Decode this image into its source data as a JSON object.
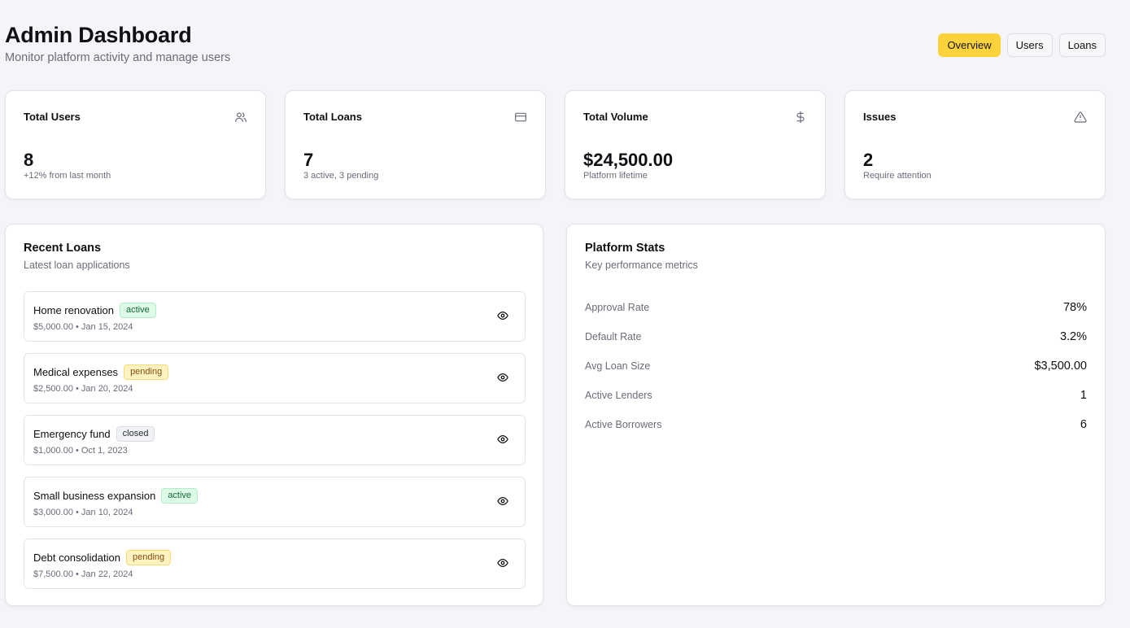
{
  "header": {
    "title": "Admin Dashboard",
    "subtitle": "Monitor platform activity and manage users"
  },
  "tabs": [
    {
      "label": "Overview",
      "active": true
    },
    {
      "label": "Users",
      "active": false
    },
    {
      "label": "Loans",
      "active": false
    }
  ],
  "stats": [
    {
      "title": "Total Users",
      "value": "8",
      "sub": "+12% from last month",
      "icon": "users-icon"
    },
    {
      "title": "Total Loans",
      "value": "7",
      "sub": "3 active, 3 pending",
      "icon": "credit-card-icon"
    },
    {
      "title": "Total Volume",
      "value": "$24,500.00",
      "sub": "Platform lifetime",
      "icon": "dollar-icon"
    },
    {
      "title": "Issues",
      "value": "2",
      "sub": "Require attention",
      "icon": "alert-triangle-icon"
    }
  ],
  "recent_loans": {
    "title": "Recent Loans",
    "subtitle": "Latest loan applications",
    "items": [
      {
        "name": "Home renovation",
        "status": "active",
        "meta": "$5,000.00 • Jan 15, 2024"
      },
      {
        "name": "Medical expenses",
        "status": "pending",
        "meta": "$2,500.00 • Jan 20, 2024"
      },
      {
        "name": "Emergency fund",
        "status": "closed",
        "meta": "$1,000.00 • Oct 1, 2023"
      },
      {
        "name": "Small business expansion",
        "status": "active",
        "meta": "$3,000.00 • Jan 10, 2024"
      },
      {
        "name": "Debt consolidation",
        "status": "pending",
        "meta": "$7,500.00 • Jan 22, 2024"
      }
    ]
  },
  "platform_stats": {
    "title": "Platform Stats",
    "subtitle": "Key performance metrics",
    "metrics": [
      {
        "label": "Approval Rate",
        "value": "78%"
      },
      {
        "label": "Default Rate",
        "value": "3.2%"
      },
      {
        "label": "Avg Loan Size",
        "value": "$3,500.00"
      },
      {
        "label": "Active Lenders",
        "value": "1"
      },
      {
        "label": "Active Borrowers",
        "value": "6"
      }
    ]
  },
  "colors": {
    "accent": "#fcd33a",
    "active_badge": "#dcfce7",
    "pending_badge": "#fef3c0",
    "closed_badge": "#f1f2f5"
  }
}
